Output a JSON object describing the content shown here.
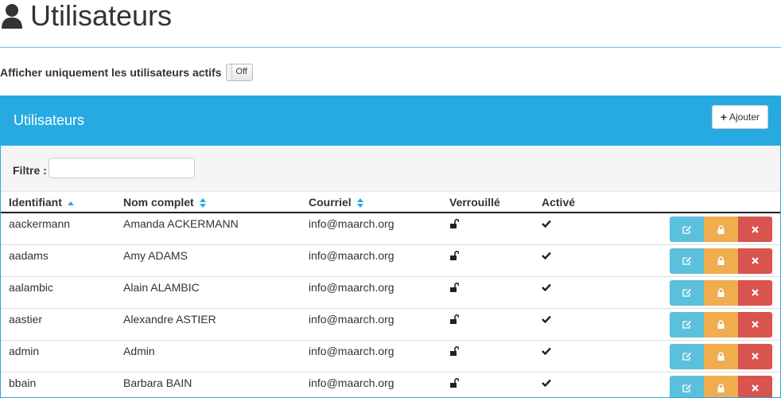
{
  "page": {
    "title": "Utilisateurs",
    "title_icon": "user-icon",
    "active_filter_label": "Afficher uniquement les utilisateurs actifs",
    "active_toggle_text": "Off"
  },
  "panel": {
    "title": "Utilisateurs",
    "add_button": "Ajouter",
    "filter_label": "Filtre :",
    "filter_value": ""
  },
  "table": {
    "columns": [
      "Identifiant",
      "Nom complet",
      "Courriel",
      "Verrouillé",
      "Activé"
    ],
    "sort_active_column": "Identifiant",
    "rows": [
      {
        "id": "aackermann",
        "name": "Amanda ACKERMANN",
        "email": "info@maarch.org",
        "locked_icon": "unlock-icon",
        "active_icon": "check-icon"
      },
      {
        "id": "aadams",
        "name": "Amy ADAMS",
        "email": "info@maarch.org",
        "locked_icon": "unlock-icon",
        "active_icon": "check-icon"
      },
      {
        "id": "aalambic",
        "name": "Alain ALAMBIC",
        "email": "info@maarch.org",
        "locked_icon": "unlock-icon",
        "active_icon": "check-icon"
      },
      {
        "id": "aastier",
        "name": "Alexandre ASTIER",
        "email": "info@maarch.org",
        "locked_icon": "unlock-icon",
        "active_icon": "check-icon"
      },
      {
        "id": "admin",
        "name": "Admin",
        "email": "info@maarch.org",
        "locked_icon": "unlock-icon",
        "active_icon": "check-icon"
      },
      {
        "id": "bbain",
        "name": "Barbara BAIN",
        "email": "info@maarch.org",
        "locked_icon": "unlock-icon",
        "active_icon": "check-icon"
      }
    ],
    "row_action_icons": [
      "edit-icon",
      "lock-icon",
      "delete-icon"
    ]
  },
  "colors": {
    "accent": "#27aae1",
    "edit_button": "#5bc0de",
    "lock_button": "#f0ad4e",
    "delete_button": "#d9534f"
  }
}
